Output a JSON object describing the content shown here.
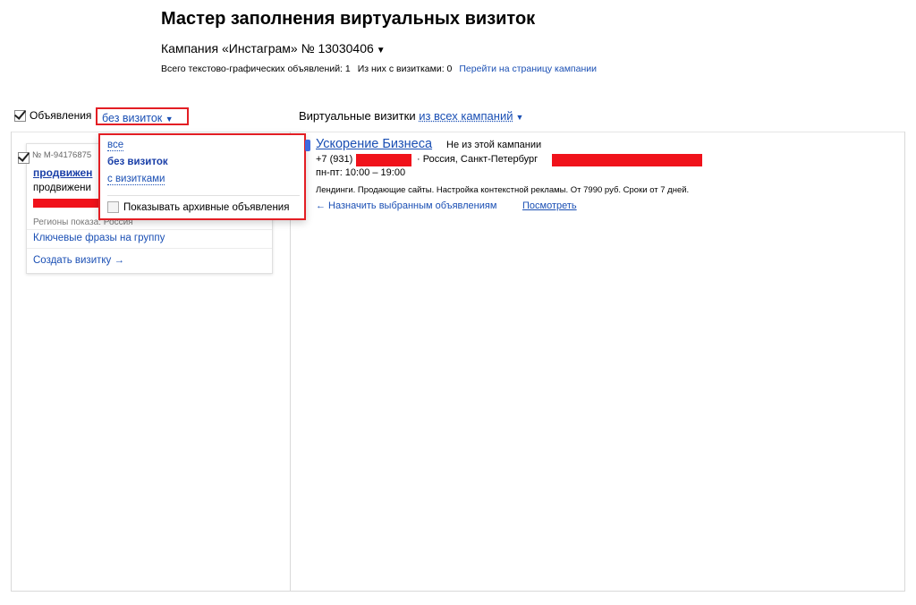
{
  "page": {
    "title": "Мастер заполнения виртуальных визиток",
    "campaign_prefix": "Кампания",
    "campaign_name": "«Инстаграм»",
    "campaign_number": "№ 13030406",
    "stats_total": "Всего текстово-графических объявлений: 1",
    "stats_with_vcards": "Из них с визитками: 0",
    "campaign_link": "Перейти на страницу кампании"
  },
  "left_panel": {
    "header_label": "Объявления",
    "filter_value": "без визиток",
    "ad": {
      "number": "№ M-94176875",
      "title": "продвижен",
      "text": "продвижени",
      "regions": "Регионы показа: Россия",
      "keyphrases_link": "Ключевые фразы на группу",
      "create_link": "Создать визитку →"
    }
  },
  "dropdown": {
    "options": [
      "все",
      "без визиток",
      "с визитками"
    ],
    "selected": "без визиток",
    "archive_label": "Показывать архивные объявления"
  },
  "right_panel": {
    "header_label": "Виртуальные визитки",
    "filter_value": "из всех кампаний",
    "vcard": {
      "name": "Ускорение Бизнеса",
      "note": "Не из этой кампании",
      "phone_prefix": "+7 (931)",
      "address": "·  Россия, Санкт-Петербург",
      "hours": "пн-пт: 10:00 – 19:00",
      "description": "Лендинги. Продающие сайты. Настройка контекстной рекламы. От 7990 руб. Сроки от 7 дней.",
      "assign_link": "← Назначить выбранным объявлениям",
      "view_link": "Посмотреть"
    }
  },
  "colors": {
    "link": "#1a4fb4",
    "highlight_border": "#e31e24",
    "redaction": "#f0121b"
  }
}
